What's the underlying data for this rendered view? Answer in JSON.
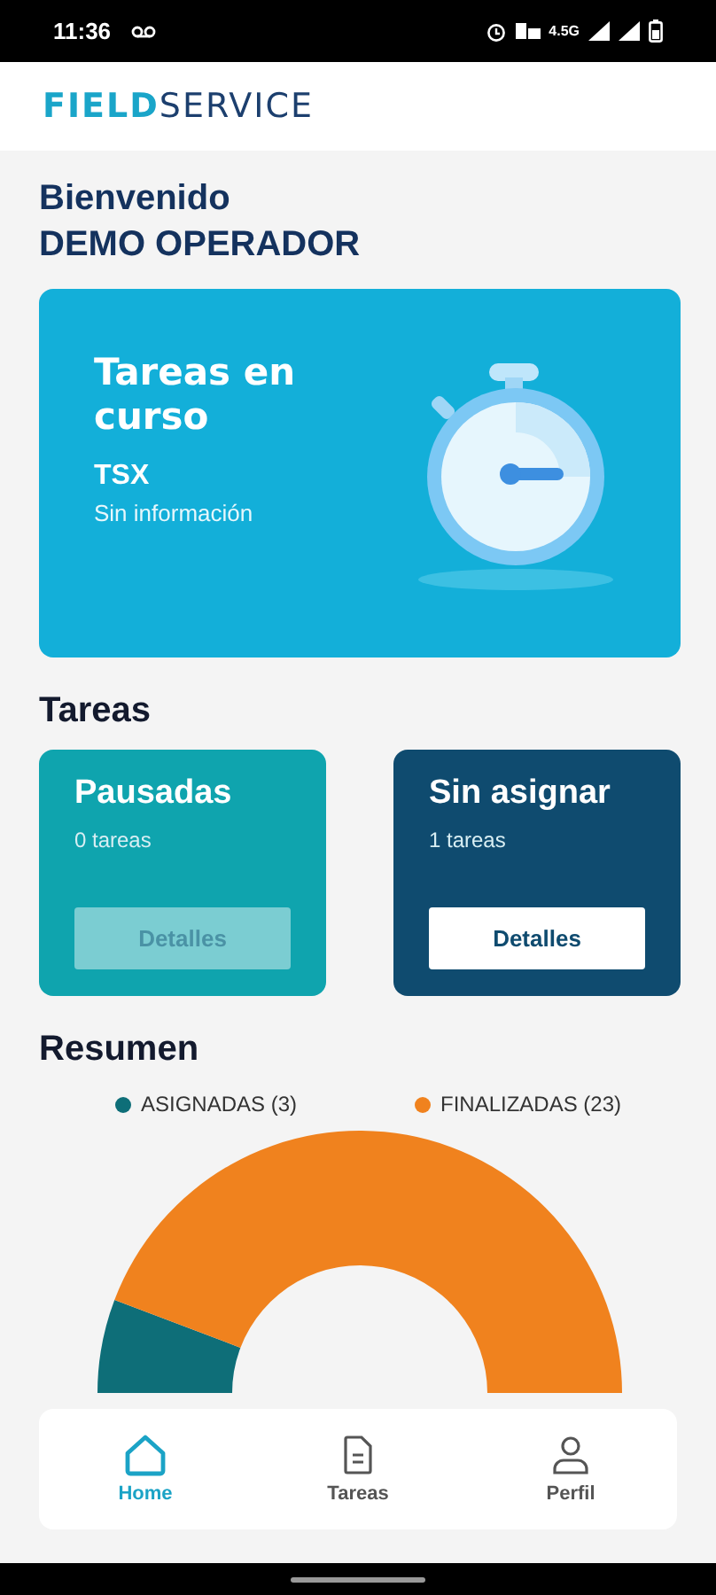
{
  "status_bar": {
    "time": "11:36",
    "network": "4.5G"
  },
  "header": {
    "logo": [
      "FIELD",
      "SERVICE"
    ]
  },
  "greeting": {
    "title": "Bienvenido",
    "user": "DEMO OPERADOR"
  },
  "current_card": {
    "title": "Tareas en curso",
    "code": "TSX",
    "info": "Sin información"
  },
  "tasks_heading": "Tareas",
  "task_cards": [
    {
      "title": "Pausadas",
      "count": "0 tareas",
      "button": "Detalles",
      "disabled": true,
      "color": "#0fa4ae"
    },
    {
      "title": "Sin asignar",
      "count": "1 tareas",
      "button": "Detalles",
      "disabled": false,
      "color": "#0f4b6f"
    }
  ],
  "summary": {
    "heading": "Resumen",
    "chart_data": {
      "type": "donut",
      "categories": [
        "ASIGNADAS (3)",
        "FINALIZADAS (23)"
      ],
      "values": [
        3,
        23
      ],
      "colors": [
        "#0e6e78",
        "#f0821e"
      ]
    }
  },
  "nav": [
    {
      "label": "Home",
      "kind": "home",
      "selected": true
    },
    {
      "label": "Tareas",
      "kind": "document",
      "selected": false
    },
    {
      "label": "Perfil",
      "kind": "person",
      "selected": false
    }
  ]
}
